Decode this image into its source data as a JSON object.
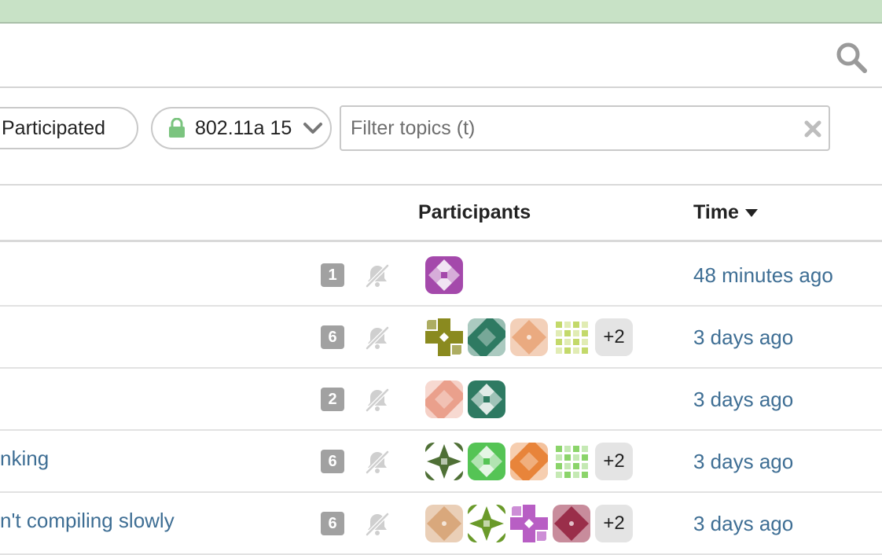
{
  "filters": {
    "participated_label": "Participated",
    "category_label": "802.11a 15",
    "filter_placeholder": "Filter topics (t)"
  },
  "table": {
    "col_participants": "Participants",
    "col_time": "Time"
  },
  "colors": {
    "banner": "#c8e2c6",
    "link": "#3e6e94",
    "lock": "#7bc47f"
  },
  "topics": [
    {
      "title": "",
      "replies": "1",
      "avatars": [
        {
          "color": "#a449ab",
          "pattern": "flower"
        }
      ],
      "more": "",
      "time": "48 minutes ago"
    },
    {
      "title": "",
      "replies": "6",
      "avatars": [
        {
          "color": "#8a8a1f",
          "pattern": "cross"
        },
        {
          "color": "#2e7a62",
          "pattern": "triangles"
        },
        {
          "color": "#eaaa80",
          "pattern": "diamond"
        },
        {
          "color": "#c3d96a",
          "pattern": "grid"
        }
      ],
      "more": "+2",
      "time": "3 days ago"
    },
    {
      "title": "",
      "replies": "2",
      "avatars": [
        {
          "color": "#eaa08c",
          "pattern": "triangles"
        },
        {
          "color": "#2e7a62",
          "pattern": "flower"
        }
      ],
      "more": "",
      "time": "3 days ago"
    },
    {
      "title": "nking",
      "replies": "6",
      "avatars": [
        {
          "color": "#4f7036",
          "pattern": "star"
        },
        {
          "color": "#55c455",
          "pattern": "flower"
        },
        {
          "color": "#e8843a",
          "pattern": "triangles"
        },
        {
          "color": "#8bd46a",
          "pattern": "grid"
        }
      ],
      "more": "+2",
      "time": "3 days ago"
    },
    {
      "title": "n't compiling slowly",
      "replies": "6",
      "avatars": [
        {
          "color": "#d9a87c",
          "pattern": "diamond"
        },
        {
          "color": "#6a9a2a",
          "pattern": "star"
        },
        {
          "color": "#b85ec4",
          "pattern": "cross"
        },
        {
          "color": "#9a2e4a",
          "pattern": "diamond"
        }
      ],
      "more": "+2",
      "time": "3 days ago"
    }
  ]
}
